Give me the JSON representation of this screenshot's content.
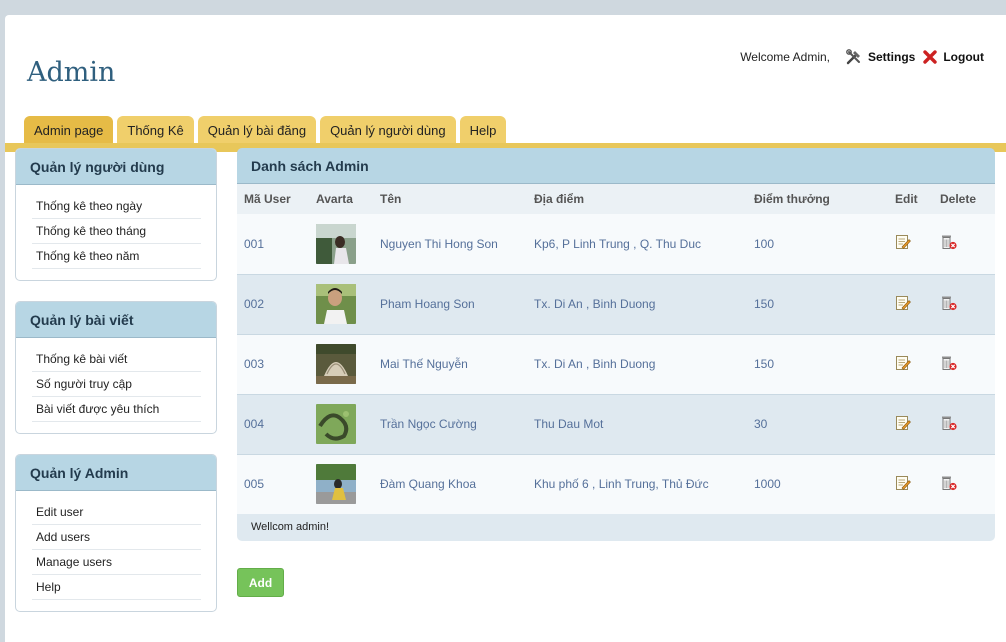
{
  "header": {
    "site_title": "Admin",
    "welcome": "Welcome Admin,",
    "settings_label": "Settings",
    "logout_label": "Logout"
  },
  "tabs": [
    {
      "label": "Admin page"
    },
    {
      "label": "Thống Kê"
    },
    {
      "label": "Quản lý bài đăng"
    },
    {
      "label": "Quản lý người dùng"
    },
    {
      "label": "Help"
    }
  ],
  "sidebar": [
    {
      "title": "Quản lý người dùng",
      "items": [
        "Thống kê theo ngày",
        "Thống kê theo tháng",
        "Thống kê theo năm"
      ]
    },
    {
      "title": "Quản lý bài viết",
      "items": [
        "Thống kê bài viết",
        "Số người truy cập",
        "Bài viết được yêu thích"
      ]
    },
    {
      "title": "Quản lý Admin",
      "items": [
        "Edit user",
        "Add users",
        "Manage users",
        "Help"
      ]
    }
  ],
  "main": {
    "title": "Danh sách Admin",
    "columns": [
      "Mã User",
      "Avarta",
      "Tên",
      "Địa điểm",
      "Điểm thưởng",
      "Edit",
      "Delete"
    ],
    "rows": [
      {
        "id": "001",
        "name": "Nguyen Thi Hong Son",
        "location": "Kp6, P Linh Trung , Q. Thu Duc",
        "points": "100"
      },
      {
        "id": "002",
        "name": "Pham Hoang Son",
        "location": "Tx. Di An , Binh Duong",
        "points": "150"
      },
      {
        "id": "003",
        "name": "Mai Thế Nguyễn",
        "location": "Tx. Di An , Binh Duong",
        "points": "150"
      },
      {
        "id": "004",
        "name": "Trần Ngọc Cường",
        "location": "Thu Dau Mot",
        "points": "30"
      },
      {
        "id": "005",
        "name": "Đàm Quang Khoa",
        "location": "Khu phố 6 , Linh Trung, Thủ Đức",
        "points": "1000"
      }
    ],
    "footer": "Wellcom admin!",
    "add_label": "Add"
  },
  "colors": {
    "accent_tab": "#f0cf6b",
    "panel_header": "#b7d6e4",
    "add_button": "#76c35a"
  }
}
